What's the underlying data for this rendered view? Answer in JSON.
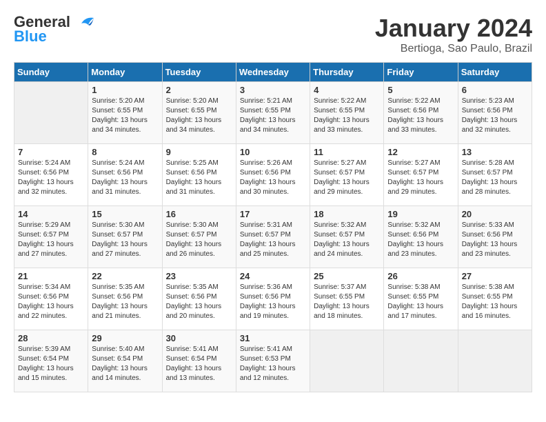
{
  "logo": {
    "line1": "General",
    "line2": "Blue"
  },
  "title": "January 2024",
  "location": "Bertioga, Sao Paulo, Brazil",
  "weekdays": [
    "Sunday",
    "Monday",
    "Tuesday",
    "Wednesday",
    "Thursday",
    "Friday",
    "Saturday"
  ],
  "weeks": [
    [
      {
        "day": "",
        "info": ""
      },
      {
        "day": "1",
        "info": "Sunrise: 5:20 AM\nSunset: 6:55 PM\nDaylight: 13 hours\nand 34 minutes."
      },
      {
        "day": "2",
        "info": "Sunrise: 5:20 AM\nSunset: 6:55 PM\nDaylight: 13 hours\nand 34 minutes."
      },
      {
        "day": "3",
        "info": "Sunrise: 5:21 AM\nSunset: 6:55 PM\nDaylight: 13 hours\nand 34 minutes."
      },
      {
        "day": "4",
        "info": "Sunrise: 5:22 AM\nSunset: 6:55 PM\nDaylight: 13 hours\nand 33 minutes."
      },
      {
        "day": "5",
        "info": "Sunrise: 5:22 AM\nSunset: 6:56 PM\nDaylight: 13 hours\nand 33 minutes."
      },
      {
        "day": "6",
        "info": "Sunrise: 5:23 AM\nSunset: 6:56 PM\nDaylight: 13 hours\nand 32 minutes."
      }
    ],
    [
      {
        "day": "7",
        "info": "Sunrise: 5:24 AM\nSunset: 6:56 PM\nDaylight: 13 hours\nand 32 minutes."
      },
      {
        "day": "8",
        "info": "Sunrise: 5:24 AM\nSunset: 6:56 PM\nDaylight: 13 hours\nand 31 minutes."
      },
      {
        "day": "9",
        "info": "Sunrise: 5:25 AM\nSunset: 6:56 PM\nDaylight: 13 hours\nand 31 minutes."
      },
      {
        "day": "10",
        "info": "Sunrise: 5:26 AM\nSunset: 6:56 PM\nDaylight: 13 hours\nand 30 minutes."
      },
      {
        "day": "11",
        "info": "Sunrise: 5:27 AM\nSunset: 6:57 PM\nDaylight: 13 hours\nand 29 minutes."
      },
      {
        "day": "12",
        "info": "Sunrise: 5:27 AM\nSunset: 6:57 PM\nDaylight: 13 hours\nand 29 minutes."
      },
      {
        "day": "13",
        "info": "Sunrise: 5:28 AM\nSunset: 6:57 PM\nDaylight: 13 hours\nand 28 minutes."
      }
    ],
    [
      {
        "day": "14",
        "info": "Sunrise: 5:29 AM\nSunset: 6:57 PM\nDaylight: 13 hours\nand 27 minutes."
      },
      {
        "day": "15",
        "info": "Sunrise: 5:30 AM\nSunset: 6:57 PM\nDaylight: 13 hours\nand 27 minutes."
      },
      {
        "day": "16",
        "info": "Sunrise: 5:30 AM\nSunset: 6:57 PM\nDaylight: 13 hours\nand 26 minutes."
      },
      {
        "day": "17",
        "info": "Sunrise: 5:31 AM\nSunset: 6:57 PM\nDaylight: 13 hours\nand 25 minutes."
      },
      {
        "day": "18",
        "info": "Sunrise: 5:32 AM\nSunset: 6:57 PM\nDaylight: 13 hours\nand 24 minutes."
      },
      {
        "day": "19",
        "info": "Sunrise: 5:32 AM\nSunset: 6:56 PM\nDaylight: 13 hours\nand 23 minutes."
      },
      {
        "day": "20",
        "info": "Sunrise: 5:33 AM\nSunset: 6:56 PM\nDaylight: 13 hours\nand 23 minutes."
      }
    ],
    [
      {
        "day": "21",
        "info": "Sunrise: 5:34 AM\nSunset: 6:56 PM\nDaylight: 13 hours\nand 22 minutes."
      },
      {
        "day": "22",
        "info": "Sunrise: 5:35 AM\nSunset: 6:56 PM\nDaylight: 13 hours\nand 21 minutes."
      },
      {
        "day": "23",
        "info": "Sunrise: 5:35 AM\nSunset: 6:56 PM\nDaylight: 13 hours\nand 20 minutes."
      },
      {
        "day": "24",
        "info": "Sunrise: 5:36 AM\nSunset: 6:56 PM\nDaylight: 13 hours\nand 19 minutes."
      },
      {
        "day": "25",
        "info": "Sunrise: 5:37 AM\nSunset: 6:55 PM\nDaylight: 13 hours\nand 18 minutes."
      },
      {
        "day": "26",
        "info": "Sunrise: 5:38 AM\nSunset: 6:55 PM\nDaylight: 13 hours\nand 17 minutes."
      },
      {
        "day": "27",
        "info": "Sunrise: 5:38 AM\nSunset: 6:55 PM\nDaylight: 13 hours\nand 16 minutes."
      }
    ],
    [
      {
        "day": "28",
        "info": "Sunrise: 5:39 AM\nSunset: 6:54 PM\nDaylight: 13 hours\nand 15 minutes."
      },
      {
        "day": "29",
        "info": "Sunrise: 5:40 AM\nSunset: 6:54 PM\nDaylight: 13 hours\nand 14 minutes."
      },
      {
        "day": "30",
        "info": "Sunrise: 5:41 AM\nSunset: 6:54 PM\nDaylight: 13 hours\nand 13 minutes."
      },
      {
        "day": "31",
        "info": "Sunrise: 5:41 AM\nSunset: 6:53 PM\nDaylight: 13 hours\nand 12 minutes."
      },
      {
        "day": "",
        "info": ""
      },
      {
        "day": "",
        "info": ""
      },
      {
        "day": "",
        "info": ""
      }
    ]
  ]
}
